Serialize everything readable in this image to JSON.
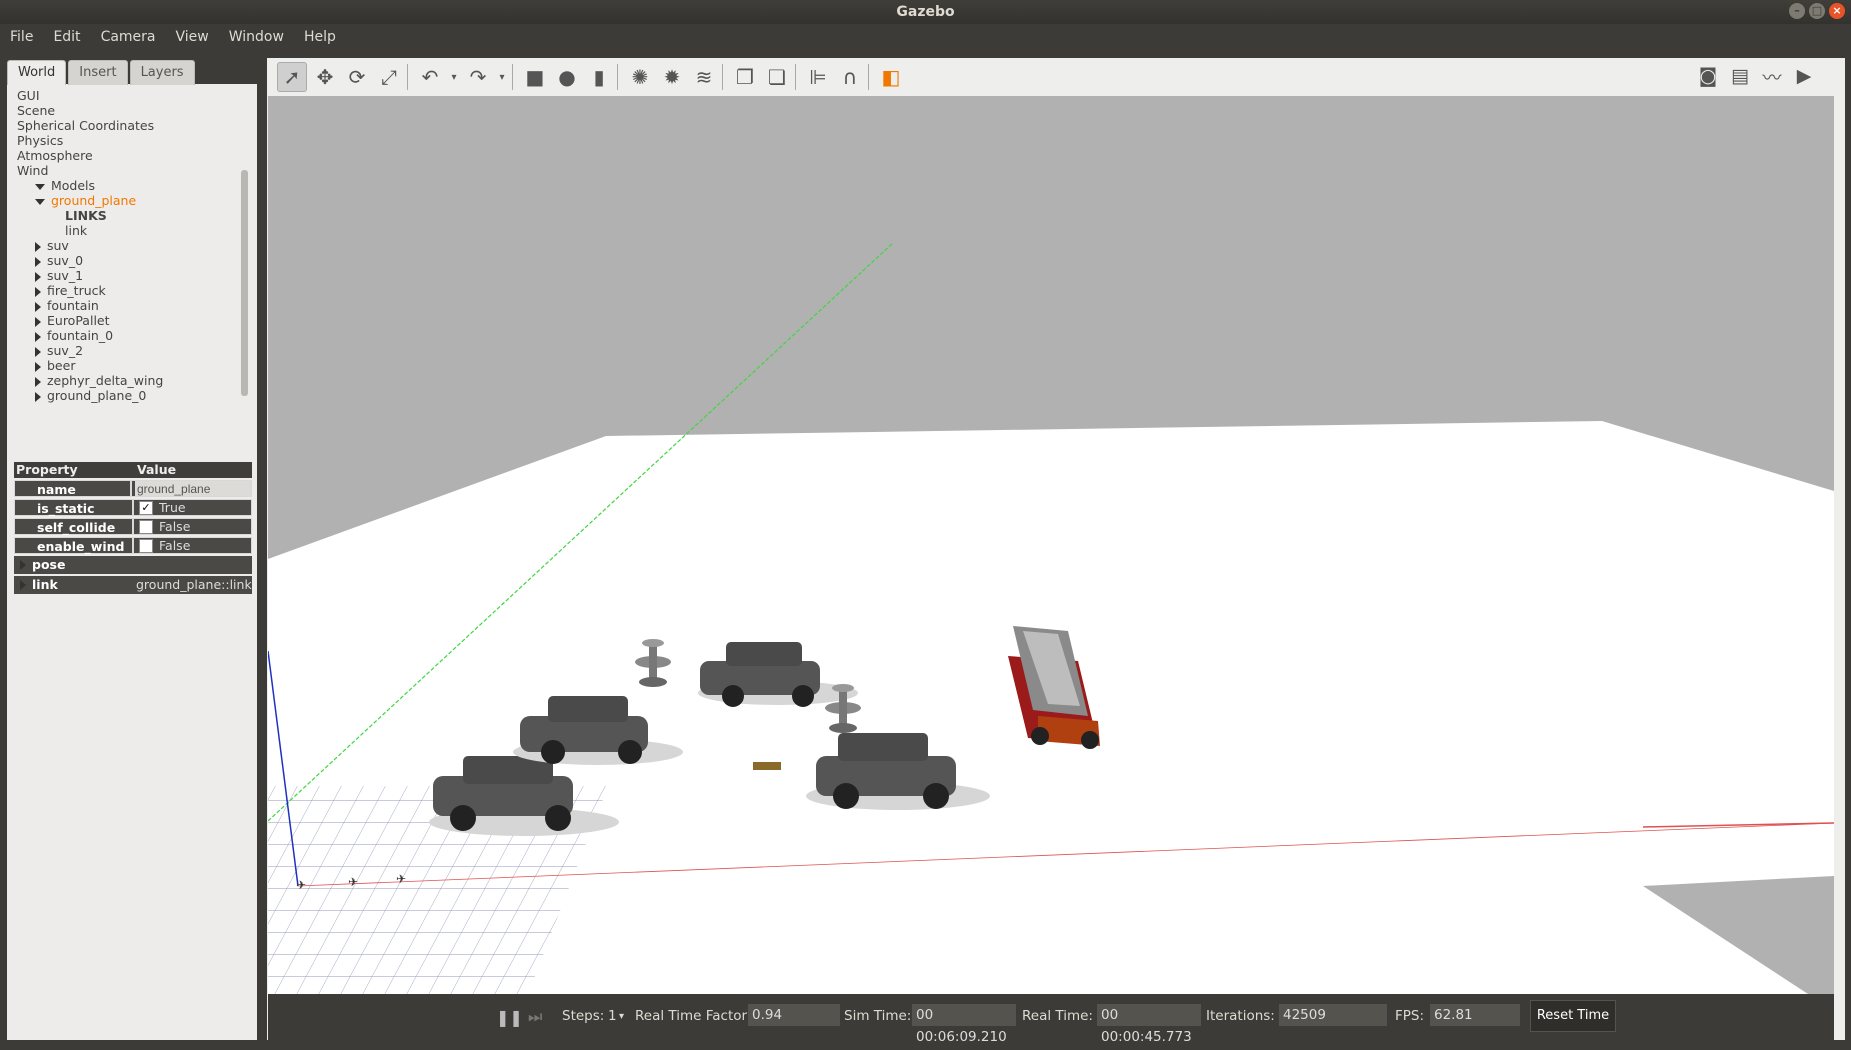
{
  "window": {
    "title": "Gazebo"
  },
  "menu": [
    "File",
    "Edit",
    "Camera",
    "View",
    "Window",
    "Help"
  ],
  "tabs": [
    "World",
    "Insert",
    "Layers"
  ],
  "tree": [
    {
      "label": "GUI",
      "level": 1,
      "arrow": "none"
    },
    {
      "label": "Scene",
      "level": 1,
      "arrow": "none"
    },
    {
      "label": "Spherical Coordinates",
      "level": 1,
      "arrow": "none"
    },
    {
      "label": "Physics",
      "level": 1,
      "arrow": "none"
    },
    {
      "label": "Atmosphere",
      "level": 1,
      "arrow": "none"
    },
    {
      "label": "Wind",
      "level": 1,
      "arrow": "none"
    },
    {
      "label": "Models",
      "level": 0,
      "arrow": "down"
    },
    {
      "label": "ground_plane",
      "level": 2,
      "arrow": "down",
      "selected": true
    },
    {
      "label": "LINKS",
      "level": 3,
      "arrow": "none",
      "bold": true
    },
    {
      "label": "link",
      "level": 3,
      "arrow": "none"
    },
    {
      "label": "suv",
      "level": 2,
      "arrow": "right"
    },
    {
      "label": "suv_0",
      "level": 2,
      "arrow": "right"
    },
    {
      "label": "suv_1",
      "level": 2,
      "arrow": "right"
    },
    {
      "label": "fire_truck",
      "level": 2,
      "arrow": "right"
    },
    {
      "label": "fountain",
      "level": 2,
      "arrow": "right"
    },
    {
      "label": "EuroPallet",
      "level": 2,
      "arrow": "right"
    },
    {
      "label": "fountain_0",
      "level": 2,
      "arrow": "right"
    },
    {
      "label": "suv_2",
      "level": 2,
      "arrow": "right"
    },
    {
      "label": "beer",
      "level": 2,
      "arrow": "right"
    },
    {
      "label": "zephyr_delta_wing",
      "level": 2,
      "arrow": "right"
    },
    {
      "label": "ground_plane_0",
      "level": 2,
      "arrow": "right"
    }
  ],
  "props": {
    "header_property": "Property",
    "header_value": "Value",
    "name_key": "name",
    "name_value": "ground_plane",
    "is_static_key": "is_static",
    "is_static_value": "True",
    "is_static_checked": true,
    "self_collide_key": "self_collide",
    "self_collide_value": "False",
    "enable_wind_key": "enable_wind",
    "enable_wind_value": "False",
    "pose_key": "pose",
    "link_key": "link",
    "link_value": "ground_plane::link"
  },
  "bottom": {
    "steps_label": "Steps:",
    "steps_value": "1",
    "rtf_label": "Real Time Factor:",
    "rtf_value": "0.94",
    "sim_label": "Sim Time:",
    "sim_value": "00 00:06:09.210",
    "real_label": "Real Time:",
    "real_value": "00 00:00:45.773",
    "iter_label": "Iterations:",
    "iter_value": "42509",
    "fps_label": "FPS:",
    "fps_value": "62.81",
    "reset_label": "Reset Time"
  },
  "colors": {
    "selected_item": "#f07800",
    "accent": "#e8542a"
  }
}
